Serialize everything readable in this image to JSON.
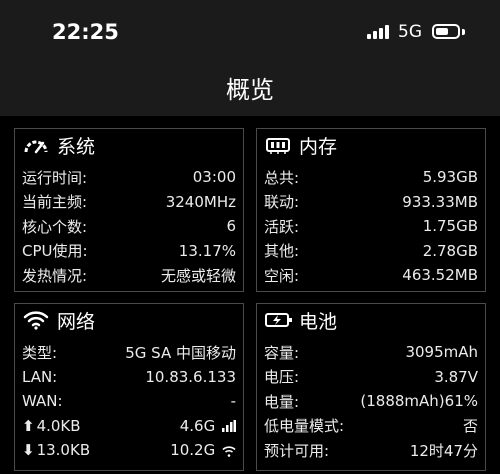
{
  "status_bar": {
    "time": "22:25",
    "network": "5G"
  },
  "page_title": "概览",
  "system": {
    "title": "系统",
    "rows": [
      {
        "label": "运行时间:",
        "value": "03:00"
      },
      {
        "label": "当前主频:",
        "value": "3240MHz"
      },
      {
        "label": "核心个数:",
        "value": "6"
      },
      {
        "label": "CPU使用:",
        "value": "13.17%"
      },
      {
        "label": "发热情况:",
        "value": "无感或轻微"
      }
    ]
  },
  "memory": {
    "title": "内存",
    "rows": [
      {
        "label": "总共:",
        "value": "5.93GB"
      },
      {
        "label": "联动:",
        "value": "933.33MB"
      },
      {
        "label": "活跃:",
        "value": "1.75GB"
      },
      {
        "label": "其他:",
        "value": "2.78GB"
      },
      {
        "label": "空闲:",
        "value": "463.52MB"
      }
    ]
  },
  "network": {
    "title": "网络",
    "rows": [
      {
        "label": "类型:",
        "value": "5G SA 中国移动"
      },
      {
        "label": "LAN:",
        "value": "10.83.6.133"
      },
      {
        "label": "WAN:",
        "value": "-"
      }
    ],
    "upload": {
      "arrow": "⬆",
      "value": "4.0KB",
      "right": "4.6G"
    },
    "download": {
      "arrow": "⬇",
      "value": "13.0KB",
      "right": "10.2G"
    }
  },
  "battery": {
    "title": "电池",
    "rows": [
      {
        "label": "容量:",
        "value": "3095mAh"
      },
      {
        "label": "电压:",
        "value": "3.87V"
      },
      {
        "label": "电量:",
        "value": "(1888mAh)61%"
      },
      {
        "label": "低电量模式:",
        "value": "否"
      },
      {
        "label": "预计可用:",
        "value": "12时47分"
      }
    ]
  },
  "colors": {
    "background": "#000000",
    "header": "#1b1b1b",
    "border": "#4a4a4a",
    "text": "#f2f2f2"
  }
}
